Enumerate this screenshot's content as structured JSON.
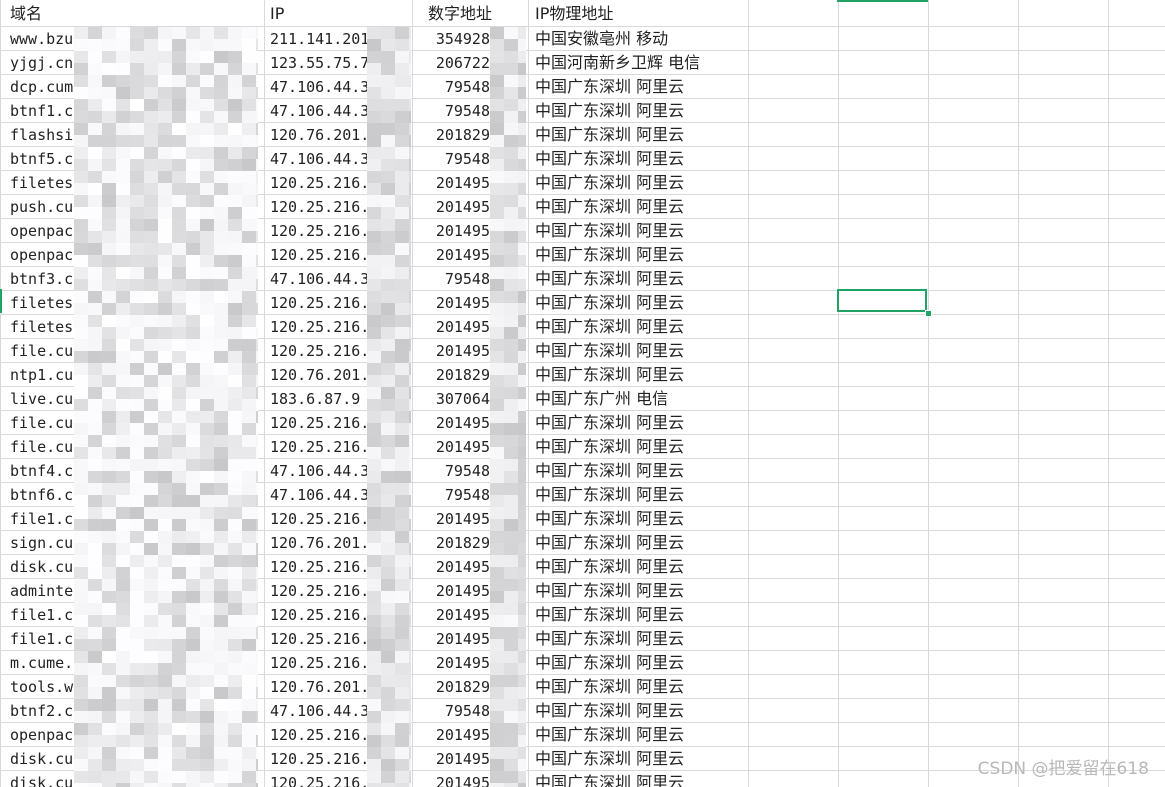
{
  "columns": {
    "domain": "域名",
    "ip": "IP",
    "num": "数字地址",
    "loc": "IP物理地址"
  },
  "rows": [
    {
      "domain": "www.bzu",
      "ip": "211.141.201",
      "num": "354928",
      "loc": "中国安徽亳州 移动"
    },
    {
      "domain": "yjgj.cn",
      "ip": "123.55.75.7",
      "num": "206722",
      "loc": "中国河南新乡卫辉 电信"
    },
    {
      "domain": "dcp.cum",
      "ip": "47.106.44.3",
      "num": "79548",
      "loc": "中国广东深圳 阿里云"
    },
    {
      "domain": "btnf1.c",
      "ip": "47.106.44.3",
      "num": "79548",
      "loc": "中国广东深圳 阿里云"
    },
    {
      "domain": "flashsi",
      "ip": "120.76.201.",
      "num": "201829",
      "loc": "中国广东深圳 阿里云"
    },
    {
      "domain": "btnf5.c",
      "ip": "47.106.44.3",
      "num": "79548",
      "loc": "中国广东深圳 阿里云"
    },
    {
      "domain": "filetes",
      "ip": "120.25.216.",
      "num": "201495",
      "loc": "中国广东深圳 阿里云"
    },
    {
      "domain": "push.cu",
      "ip": "120.25.216.",
      "num": "201495",
      "loc": "中国广东深圳 阿里云"
    },
    {
      "domain": "openpac",
      "ip": "120.25.216.",
      "num": "201495",
      "loc": "中国广东深圳 阿里云"
    },
    {
      "domain": "openpac",
      "ip": "120.25.216.",
      "num": "201495",
      "loc": "中国广东深圳 阿里云"
    },
    {
      "domain": "btnf3.c",
      "ip": "47.106.44.3",
      "num": "79548",
      "loc": "中国广东深圳 阿里云"
    },
    {
      "domain": "filetes",
      "ip": "120.25.216.",
      "num": "201495",
      "loc": "中国广东深圳 阿里云"
    },
    {
      "domain": "filetes",
      "ip": "120.25.216.",
      "num": "201495",
      "loc": "中国广东深圳 阿里云"
    },
    {
      "domain": "file.cu",
      "ip": "120.25.216.",
      "num": "201495",
      "loc": "中国广东深圳 阿里云"
    },
    {
      "domain": "ntp1.cu",
      "ip": "120.76.201.",
      "num": "201829",
      "loc": "中国广东深圳 阿里云"
    },
    {
      "domain": "live.cu",
      "ip": "183.6.87.9",
      "num": "307064",
      "loc": "中国广东广州 电信"
    },
    {
      "domain": "file.cu",
      "ip": "120.25.216.",
      "num": "201495",
      "loc": "中国广东深圳 阿里云"
    },
    {
      "domain": "file.cu",
      "ip": "120.25.216.",
      "num": "201495",
      "loc": "中国广东深圳 阿里云"
    },
    {
      "domain": "btnf4.c",
      "ip": "47.106.44.3",
      "num": "79548",
      "loc": "中国广东深圳 阿里云"
    },
    {
      "domain": "btnf6.c",
      "ip": "47.106.44.3",
      "num": "79548",
      "loc": "中国广东深圳 阿里云"
    },
    {
      "domain": "file1.c",
      "ip": "120.25.216.",
      "num": "201495",
      "loc": "中国广东深圳 阿里云"
    },
    {
      "domain": "sign.cu",
      "ip": "120.76.201.",
      "num": "201829",
      "loc": "中国广东深圳 阿里云"
    },
    {
      "domain": "disk.cu",
      "ip": "120.25.216.",
      "num": "201495",
      "loc": "中国广东深圳 阿里云"
    },
    {
      "domain": "adminte",
      "ip": "120.25.216.",
      "num": "201495",
      "loc": "中国广东深圳 阿里云"
    },
    {
      "domain": "file1.c",
      "ip": "120.25.216.",
      "num": "201495",
      "loc": "中国广东深圳 阿里云"
    },
    {
      "domain": "file1.c",
      "ip": "120.25.216.",
      "num": "201495",
      "loc": "中国广东深圳 阿里云"
    },
    {
      "domain": "m.cume.",
      "ip": "120.25.216.",
      "num": "201495",
      "loc": "中国广东深圳 阿里云"
    },
    {
      "domain": "tools.w",
      "ip": "120.76.201.",
      "num": "201829",
      "loc": "中国广东深圳 阿里云"
    },
    {
      "domain": "btnf2.c",
      "ip": "47.106.44.3",
      "num": "79548",
      "loc": "中国广东深圳 阿里云"
    },
    {
      "domain": "openpac",
      "ip": "120.25.216.",
      "num": "201495",
      "loc": "中国广东深圳 阿里云"
    },
    {
      "domain": "disk.cu",
      "ip": "120.25.216.",
      "num": "201495",
      "loc": "中国广东深圳 阿里云"
    },
    {
      "domain": "disk.cume.cc",
      "ip": "120.25.216.",
      "num": "201495",
      "loc": "中国广东深圳 阿里云"
    }
  ],
  "watermark": "CSDN @把爱留在618",
  "colors": {
    "grid": "#d9d9d9",
    "selection": "#21a366",
    "text": "#222222"
  }
}
